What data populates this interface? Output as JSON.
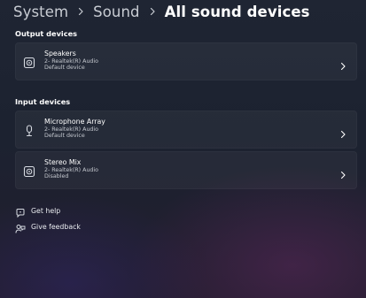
{
  "breadcrumb": {
    "items": [
      "System",
      "Sound",
      "All sound devices"
    ]
  },
  "output": {
    "section_title": "Output devices",
    "devices": [
      {
        "name": "Speakers",
        "driver": "2- Realtek(R) Audio",
        "status": "Default device",
        "icon": "speaker-device-icon"
      }
    ]
  },
  "input": {
    "section_title": "Input devices",
    "devices": [
      {
        "name": "Microphone Array",
        "driver": "2- Realtek(R) Audio",
        "status": "Default device",
        "icon": "microphone-icon"
      },
      {
        "name": "Stereo Mix",
        "driver": "2- Realtek(R) Audio",
        "status": "Disabled",
        "icon": "speaker-device-icon"
      }
    ]
  },
  "links": {
    "help": "Get help",
    "feedback": "Give feedback"
  },
  "colors": {
    "background": "#1e2331",
    "card": "#272c39",
    "accent_text": "#ffffff",
    "secondary_text": "#c4c8cf"
  }
}
